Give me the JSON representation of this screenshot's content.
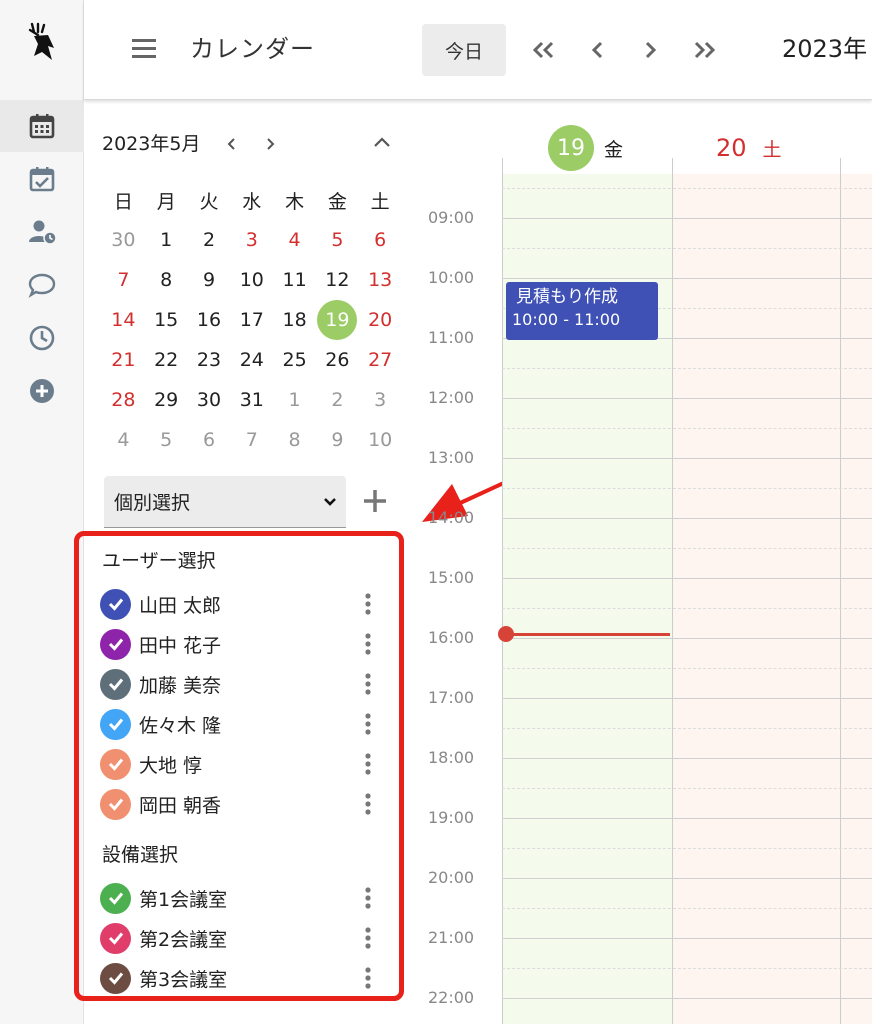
{
  "header": {
    "title": "カレンダー",
    "today_label": "今日",
    "period_label": "2023年"
  },
  "mini_calendar": {
    "month_label": "2023年5月",
    "weekdays": [
      "日",
      "月",
      "火",
      "水",
      "木",
      "金",
      "土"
    ],
    "weeks": [
      [
        "30",
        "1",
        "2",
        "3",
        "4",
        "5",
        "6"
      ],
      [
        "7",
        "8",
        "9",
        "10",
        "11",
        "12",
        "13"
      ],
      [
        "14",
        "15",
        "16",
        "17",
        "18",
        "19",
        "20"
      ],
      [
        "21",
        "22",
        "23",
        "24",
        "25",
        "26",
        "27"
      ],
      [
        "28",
        "29",
        "30",
        "31",
        "1",
        "2",
        "3"
      ],
      [
        "4",
        "5",
        "6",
        "7",
        "8",
        "9",
        "10"
      ]
    ],
    "selected_day": "19",
    "holiday_color": "#d32f2f",
    "selected_color": "#9ccc65"
  },
  "filter": {
    "selected": "個別選択",
    "users_title": "ユーザー選択",
    "users": [
      {
        "name": "山田 太郎",
        "color": "#3f51b5"
      },
      {
        "name": "田中 花子",
        "color": "#8e24aa"
      },
      {
        "name": "加藤 美奈",
        "color": "#5f6f7a"
      },
      {
        "name": "佐々木 隆",
        "color": "#42a5f5"
      },
      {
        "name": "大地 惇",
        "color": "#f09070"
      },
      {
        "name": "岡田 朝香",
        "color": "#f09070"
      }
    ],
    "facilities_title": "設備選択",
    "facilities": [
      {
        "name": "第1会議室",
        "color": "#4caf50"
      },
      {
        "name": "第2会議室",
        "color": "#e03d6a"
      },
      {
        "name": "第3会議室",
        "color": "#6d4c41"
      }
    ]
  },
  "week": {
    "days": [
      {
        "date": "19",
        "weekday": "金"
      },
      {
        "date": "20",
        "weekday": "土"
      }
    ],
    "times": [
      "09:00",
      "10:00",
      "11:00",
      "12:00",
      "13:00",
      "14:00",
      "15:00",
      "16:00",
      "17:00",
      "18:00",
      "19:00",
      "20:00",
      "21:00",
      "22:00"
    ],
    "event": {
      "title": "見積もり作成",
      "time": "10:00 - 11:00",
      "color": "#3f51b5"
    },
    "today_bg": "#f4fbec",
    "weekend_bg": "#fff5f0"
  }
}
